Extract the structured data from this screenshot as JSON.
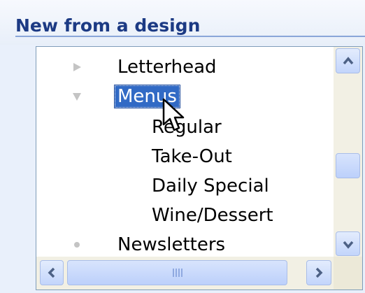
{
  "header": {
    "title": "New from a design"
  },
  "tree": {
    "items": [
      {
        "label": "Letterhead",
        "state": "collapsed",
        "selected": false,
        "level": 0
      },
      {
        "label": "Menus",
        "state": "expanded",
        "selected": true,
        "level": 0
      },
      {
        "label": "Regular",
        "state": "leaf",
        "selected": false,
        "level": 1
      },
      {
        "label": "Take-Out",
        "state": "leaf",
        "selected": false,
        "level": 1
      },
      {
        "label": "Daily Special",
        "state": "leaf",
        "selected": false,
        "level": 1
      },
      {
        "label": "Wine/Dessert",
        "state": "leaf",
        "selected": false,
        "level": 1
      },
      {
        "label": "Newsletters",
        "state": "no-children",
        "selected": false,
        "level": 0
      }
    ]
  },
  "scrollbars": {
    "vertical": {
      "up_icon": "chevron-up-icon",
      "down_icon": "chevron-down-icon"
    },
    "horizontal": {
      "left_icon": "chevron-left-icon",
      "right_icon": "chevron-right-icon"
    }
  },
  "colors": {
    "accent": "#316ac5",
    "title": "#1c3a84",
    "panel_background": "#e9f0fb",
    "scroll_arrow": "#4d6185"
  }
}
